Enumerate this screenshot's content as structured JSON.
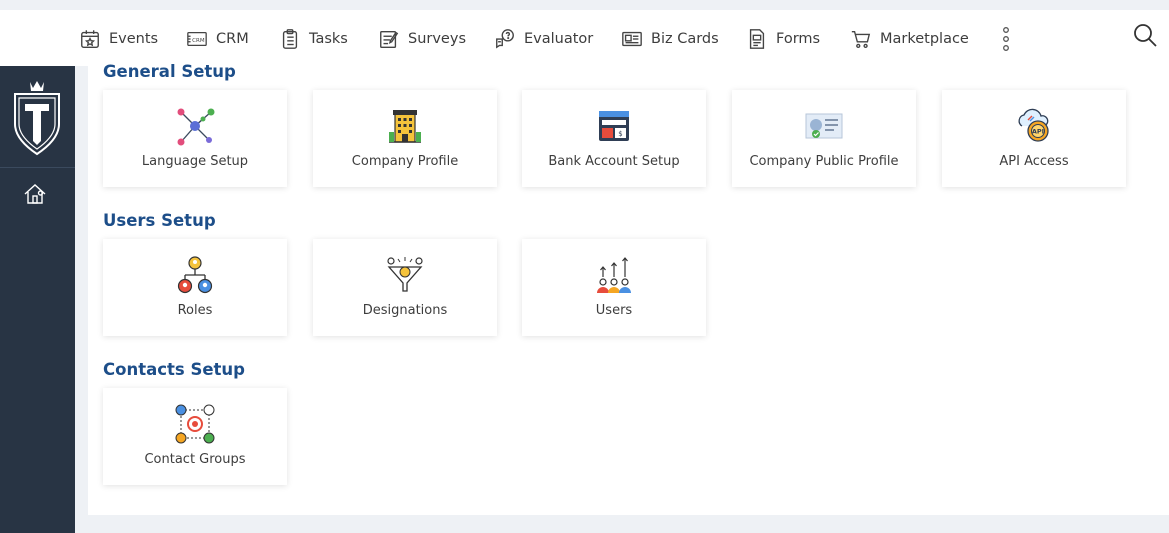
{
  "nav": {
    "items": [
      {
        "label": "Events",
        "icon": "calendar-star-icon"
      },
      {
        "label": "CRM",
        "icon": "crm-icon"
      },
      {
        "label": "Tasks",
        "icon": "clipboard-list-icon"
      },
      {
        "label": "Surveys",
        "icon": "survey-icon"
      },
      {
        "label": "Evaluator",
        "icon": "question-chat-icon"
      },
      {
        "label": "Biz Cards",
        "icon": "id-card-icon"
      },
      {
        "label": "Forms",
        "icon": "form-icon"
      },
      {
        "label": "Marketplace",
        "icon": "cart-icon"
      }
    ]
  },
  "sections": {
    "general": {
      "title": "General Setup",
      "cards": [
        {
          "label": "Language Setup",
          "icon": "network-nodes-icon"
        },
        {
          "label": "Company Profile",
          "icon": "office-building-icon"
        },
        {
          "label": "Bank Account Setup",
          "icon": "bank-account-icon"
        },
        {
          "label": "Company Public Profile",
          "icon": "public-profile-icon"
        },
        {
          "label": "API Access",
          "icon": "api-gear-icon"
        }
      ]
    },
    "users": {
      "title": "Users Setup",
      "cards": [
        {
          "label": "Roles",
          "icon": "roles-hierarchy-icon"
        },
        {
          "label": "Designations",
          "icon": "designations-funnel-icon"
        },
        {
          "label": "Users",
          "icon": "users-group-icon"
        }
      ]
    },
    "contacts": {
      "title": "Contacts Setup",
      "cards": [
        {
          "label": "Contact Groups",
          "icon": "contact-groups-icon"
        }
      ]
    }
  },
  "colors": {
    "sidebar": "#283444",
    "accent_title": "#1d4e89",
    "background": "#eef1f5"
  }
}
